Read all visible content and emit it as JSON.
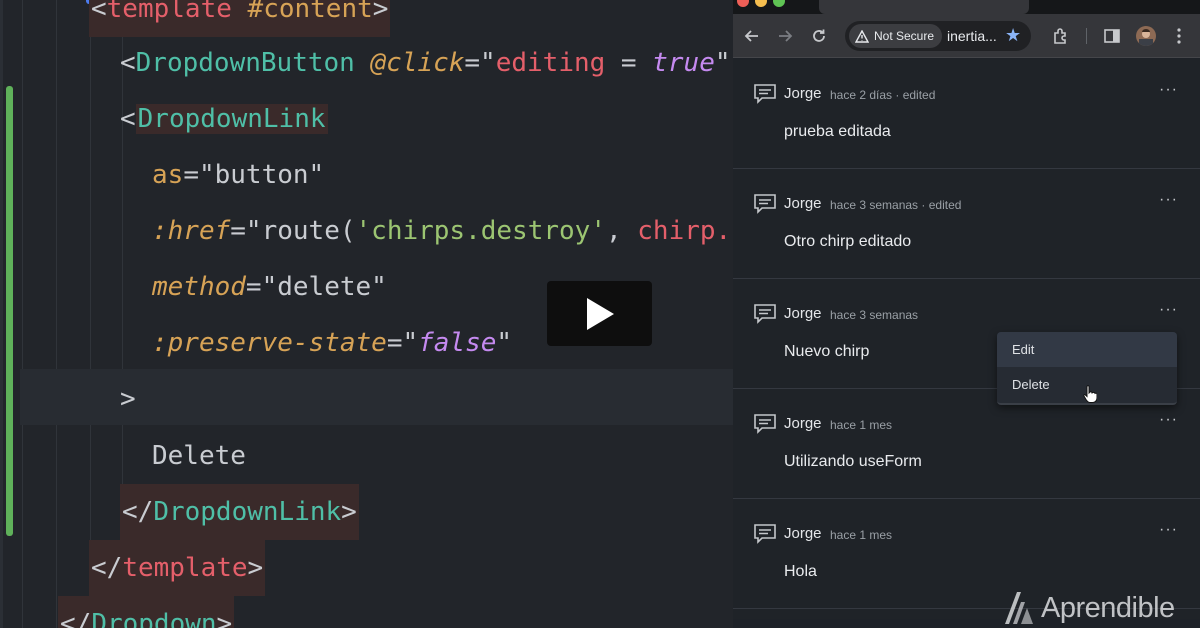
{
  "editor": {
    "lines": [
      {
        "parts": [
          {
            "t": "<",
            "c": "punct"
          },
          {
            "t": "template",
            "c": "tag-r"
          },
          {
            "t": " #content",
            "c": "attr-o"
          },
          {
            "t": ">",
            "c": "punct"
          }
        ]
      },
      {
        "parts": [
          {
            "t": "<",
            "c": "punct"
          },
          {
            "t": "DropdownButton",
            "c": "comp"
          },
          {
            "t": " ",
            "c": "plain"
          },
          {
            "t": "@click",
            "c": "attr-i"
          },
          {
            "t": "=\"",
            "c": "punct"
          },
          {
            "t": "editing",
            "c": "str-r"
          },
          {
            "t": " = ",
            "c": "plain"
          },
          {
            "t": "true",
            "c": "kw"
          },
          {
            "t": "\"",
            "c": "punct"
          }
        ]
      },
      {
        "parts": [
          {
            "t": "<",
            "c": "punct"
          },
          {
            "t": "DropdownLink",
            "c": "comp"
          }
        ]
      },
      {
        "parts": [
          {
            "t": "as",
            "c": "attr-o"
          },
          {
            "t": "=\"button\"",
            "c": "str-w"
          }
        ]
      },
      {
        "parts": [
          {
            "t": ":href",
            "c": "attr-i"
          },
          {
            "t": "=\"route(",
            "c": "str-w"
          },
          {
            "t": "'chirps.destroy'",
            "c": "str-g"
          },
          {
            "t": ", ",
            "c": "plain"
          },
          {
            "t": "chirp.",
            "c": "str-r"
          }
        ]
      },
      {
        "parts": [
          {
            "t": "method",
            "c": "attr-i"
          },
          {
            "t": "=\"delete\"",
            "c": "str-w"
          }
        ]
      },
      {
        "parts": [
          {
            "t": ":preserve-state",
            "c": "attr-i"
          },
          {
            "t": "=\"",
            "c": "str-w"
          },
          {
            "t": "false",
            "c": "kw"
          },
          {
            "t": "\"",
            "c": "str-w"
          }
        ]
      },
      {
        "parts": [
          {
            "t": ">",
            "c": "punct"
          }
        ]
      },
      {
        "parts": [
          {
            "t": "Delete",
            "c": "plain"
          }
        ]
      },
      {
        "parts": [
          {
            "t": "</",
            "c": "punct"
          },
          {
            "t": "DropdownLink",
            "c": "comp"
          },
          {
            "t": ">",
            "c": "punct"
          }
        ]
      },
      {
        "parts": [
          {
            "t": "</",
            "c": "punct"
          },
          {
            "t": "template",
            "c": "tag-r"
          },
          {
            "t": ">",
            "c": "punct"
          }
        ]
      },
      {
        "parts": [
          {
            "t": "</",
            "c": "punct"
          },
          {
            "t": "Dropdown",
            "c": "comp"
          },
          {
            "t": ">",
            "c": "punct"
          }
        ]
      }
    ]
  },
  "browser": {
    "security_label": "Not Secure",
    "url": "inertia...",
    "chirps": [
      {
        "author": "Jorge",
        "meta": "hace 2 días · edited",
        "body": "prueba editada",
        "menu": "···"
      },
      {
        "author": "Jorge",
        "meta": "hace 3 semanas · edited",
        "body": "Otro chirp editado",
        "menu": "···"
      },
      {
        "author": "Jorge",
        "meta": "hace 3 semanas",
        "body": "Nuevo chirp",
        "menu": "···"
      },
      {
        "author": "Jorge",
        "meta": "hace 1 mes",
        "body": "Utilizando useForm",
        "menu": "···"
      },
      {
        "author": "Jorge",
        "meta": "hace 1 mes",
        "body": "Hola",
        "menu": "···"
      }
    ],
    "dropdown": {
      "items": [
        "Edit",
        "Delete"
      ]
    }
  },
  "watermark": {
    "text": "Aprendible"
  },
  "colors": {
    "accent_green": "#5fb15a",
    "browser_bg": "#1f2328",
    "editor_bg": "#22252a"
  },
  "icons": [
    "play-icon",
    "back-icon",
    "forward-icon",
    "reload-icon",
    "warning-icon",
    "star-icon",
    "extensions-icon",
    "sidebar-icon",
    "kebab-icon",
    "chat-bubble-icon",
    "pointer-cursor-icon"
  ]
}
